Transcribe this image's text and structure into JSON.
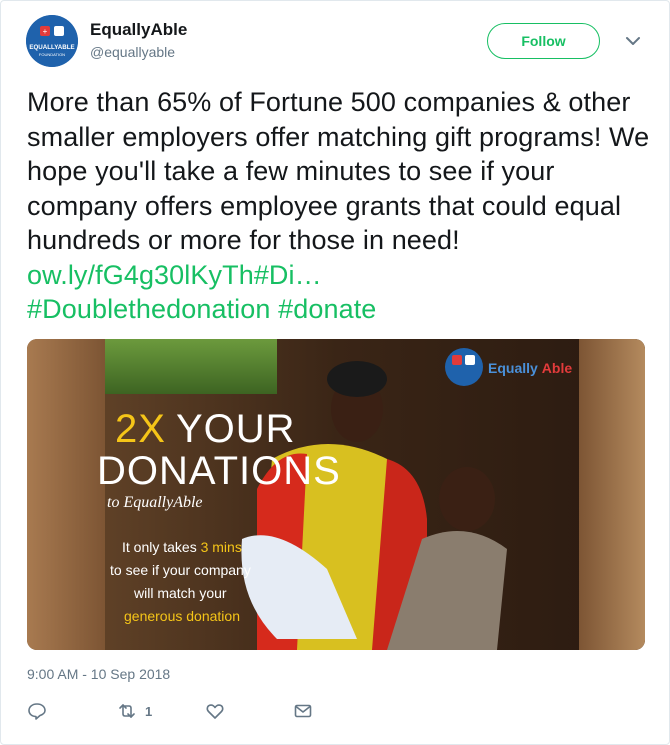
{
  "account": {
    "display_name": "EquallyAble",
    "handle": "@equallyable",
    "avatar_text": "EQUALLYABLE",
    "avatar_subtext": "FOUNDATION"
  },
  "follow_label": "Follow",
  "tweet": {
    "text": "More than 65% of Fortune 500 companies & other smaller employers offer matching gift programs! We hope you'll take a few minutes to see if your company offers employee grants that could equal hundreds or more for those in need! ",
    "link_text": "ow.ly/fG4g30lKyTh",
    "hashtag_1": "#Di…",
    "hashtag_2": "#Doublethedonation",
    "hashtag_3": "#donate"
  },
  "media": {
    "headline_prefix": "2X",
    "headline_rest": "YOUR",
    "headline_line2": "DONATIONS",
    "script_line": "to EquallyAble",
    "body_line1": "It only takes ",
    "body_highlight": "3 mins",
    "body_line2": "to see if your company",
    "body_line3": "will match your",
    "body_line4": "generous donation",
    "brand_name": "Equally",
    "brand_name_2": "Able"
  },
  "timestamp": "9:00 AM - 10 Sep 2018",
  "actions": {
    "retweet_count": "1"
  },
  "colors": {
    "accent_green": "#17bf63",
    "secondary_text": "#657786",
    "highlight_yellow": "#f5c518"
  },
  "icons": [
    "chevron-down-icon",
    "reply-icon",
    "retweet-icon",
    "like-icon",
    "message-icon"
  ]
}
